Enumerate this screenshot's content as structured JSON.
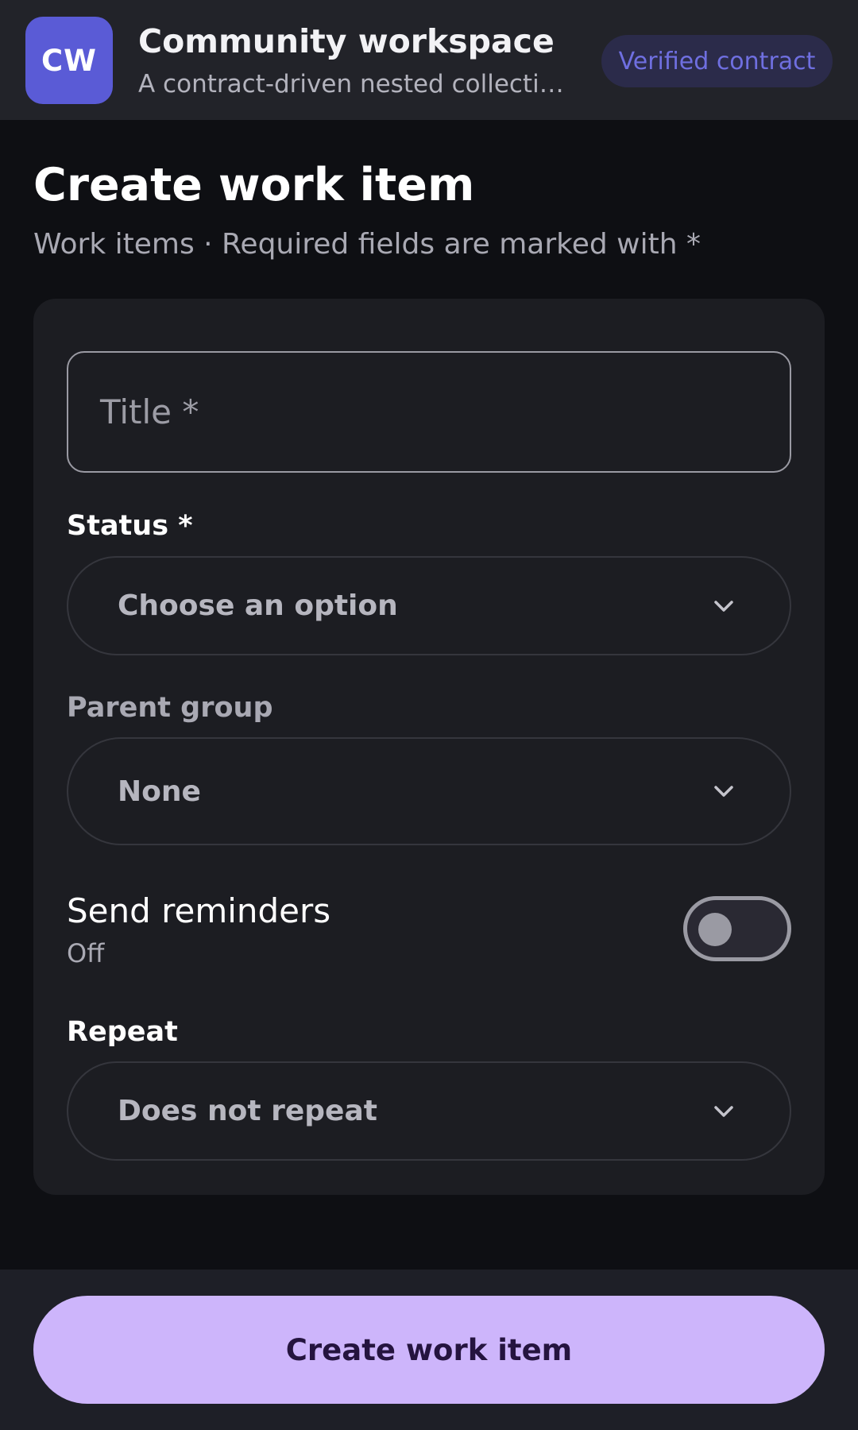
{
  "header": {
    "avatar_initials": "CW",
    "title": "Community workspace",
    "subtitle": "A contract-driven nested collection ...",
    "badge": "Verified contract"
  },
  "page": {
    "heading": "Create work item",
    "caption": "Work items · Required fields are marked with *"
  },
  "form": {
    "title_field": {
      "placeholder": "Title *",
      "value": ""
    },
    "status": {
      "label": "Status *",
      "value": "Choose an option"
    },
    "parent_group": {
      "label": "Parent group",
      "value": "None"
    },
    "reminders": {
      "label": "Send reminders",
      "state": "Off",
      "enabled": false
    },
    "repeat": {
      "label": "Repeat",
      "value": "Does not repeat"
    }
  },
  "actions": {
    "submit_label": "Create work item"
  },
  "colors": {
    "accent": "#5a5bd6",
    "primary_button": "#cdb5fb",
    "badge_text": "#6f6fe0"
  },
  "icons": {
    "select_chevron": "chevron-down-icon"
  }
}
